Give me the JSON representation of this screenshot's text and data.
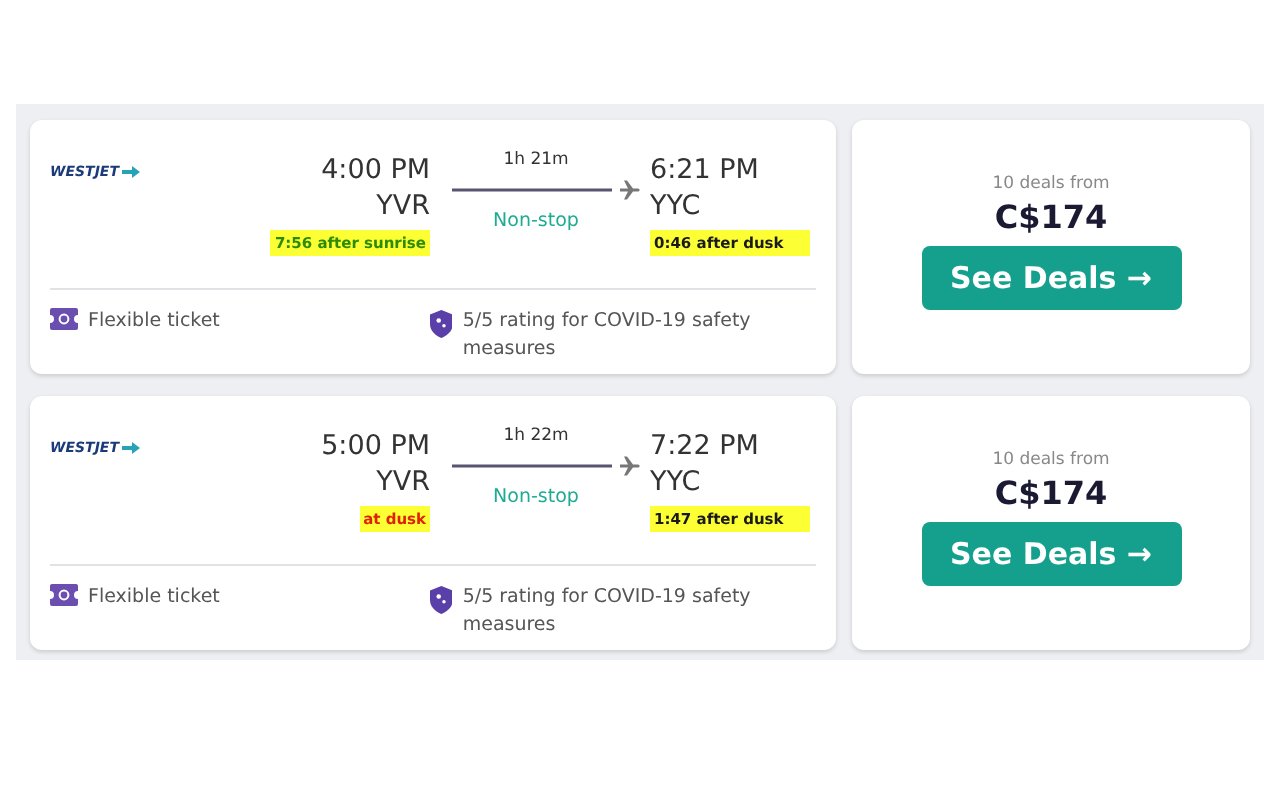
{
  "flights": [
    {
      "airline": "WESTJET",
      "depart_time": "4:00 PM",
      "depart_airport": "YVR",
      "depart_note": {
        "text": "7:56 after sunrise",
        "kind": "day"
      },
      "duration": "1h 21m",
      "stops": "Non-stop",
      "arrive_time": "6:21 PM",
      "arrive_airport": "YYC",
      "arrive_note": {
        "text": "0:46 after dusk",
        "kind": "night"
      },
      "features": [
        {
          "kind": "ticket",
          "text": "Flexible ticket"
        },
        {
          "kind": "shield",
          "text": "5/5 rating for COVID-19 safety measures"
        }
      ],
      "deals": "10 deals from",
      "price": "C$174",
      "button": "See Deals →"
    },
    {
      "airline": "WESTJET",
      "depart_time": "5:00 PM",
      "depart_airport": "YVR",
      "depart_note": {
        "text": "at dusk",
        "kind": "dusk"
      },
      "duration": "1h 22m",
      "stops": "Non-stop",
      "arrive_time": "7:22 PM",
      "arrive_airport": "YYC",
      "arrive_note": {
        "text": "1:47 after dusk",
        "kind": "night"
      },
      "features": [
        {
          "kind": "ticket",
          "text": "Flexible ticket"
        },
        {
          "kind": "shield",
          "text": "5/5 rating for COVID-19 safety measures"
        }
      ],
      "deals": "10 deals from",
      "price": "C$174",
      "button": "See Deals →"
    }
  ]
}
